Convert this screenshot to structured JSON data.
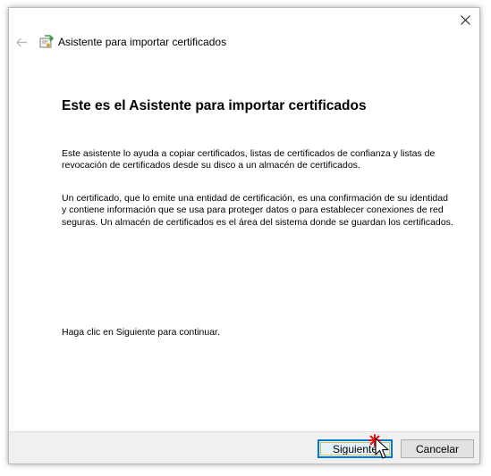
{
  "window": {
    "title": "Asistente para importar certificados",
    "close_glyph": "✕",
    "back_glyph": "←"
  },
  "content": {
    "heading": "Este es el Asistente para importar certificados",
    "paragraph1": "Este asistente lo ayuda a copiar certificados, listas de certificados de confianza y listas de revocación de certificados desde su disco a un almacén de certificados.",
    "paragraph2": "Un certificado, que lo emite una entidad de certificación, es una confirmación de su identidad y contiene información que se usa para proteger datos o para establecer conexiones de red seguras. Un almacén de certificados es el área del sistema donde se guardan los certificados.",
    "paragraph3": "Haga clic en Siguiente para continuar."
  },
  "buttons": {
    "next": "Siguiente",
    "cancel": "Cancelar"
  },
  "icons": {
    "close": "close-icon",
    "back": "back-arrow-icon",
    "certificate": "certificate-icon",
    "cursor": "mouse-pointer-icon",
    "highlight": "click-spark-icon"
  },
  "colors": {
    "focus_border": "#0078d7",
    "footer_bg": "#f0f0f0",
    "spark": "#e8141b"
  }
}
